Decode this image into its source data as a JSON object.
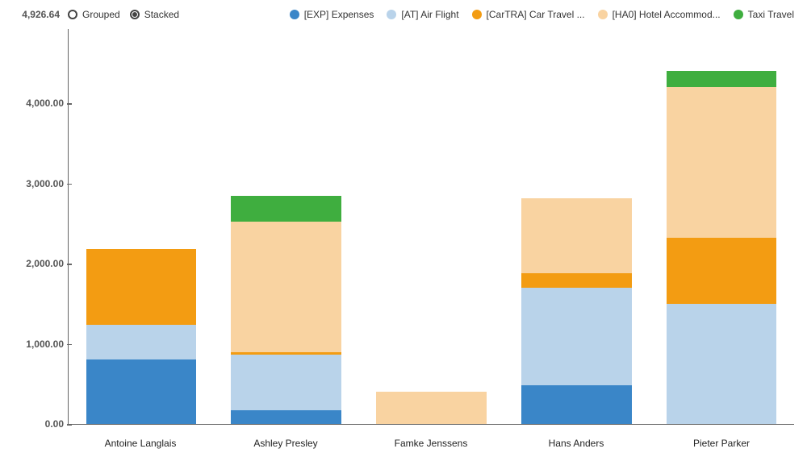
{
  "controls": {
    "grouped_label": "Grouped",
    "stacked_label": "Stacked",
    "selected": "stacked"
  },
  "legend": [
    {
      "key": "exp",
      "label": "[EXP] Expenses",
      "color": "#3a86c8"
    },
    {
      "key": "air",
      "label": "[AT] Air Flight",
      "color": "#b9d3ea"
    },
    {
      "key": "car",
      "label": "[CarTRA] Car Travel ...",
      "color": "#f39c12"
    },
    {
      "key": "hotel",
      "label": "[HA0] Hotel Accommod...",
      "color": "#f9d3a1"
    },
    {
      "key": "taxi",
      "label": "Taxi Travel",
      "color": "#3fae3f"
    }
  ],
  "max_label": "4,926.64",
  "yticks": [
    "0.00",
    "1,000.00",
    "2,000.00",
    "3,000.00",
    "4,000.00"
  ],
  "chart_data": {
    "type": "bar",
    "stacked": true,
    "ylim": [
      0,
      4926.64
    ],
    "categories": [
      "Antoine Langlais",
      "Ashley Presley",
      "Famke Jenssens",
      "Hans Anders",
      "Pieter Parker"
    ],
    "series": [
      {
        "name": "[EXP] Expenses",
        "key": "exp",
        "values": [
          800,
          170,
          0,
          480,
          0
        ]
      },
      {
        "name": "[AT] Air Flight",
        "key": "air",
        "values": [
          440,
          690,
          0,
          1220,
          1500
        ]
      },
      {
        "name": "[CarTRA] Car Travel ...",
        "key": "car",
        "values": [
          945,
          40,
          0,
          180,
          820
        ]
      },
      {
        "name": "[HA0] Hotel Accommod...",
        "key": "hotel",
        "values": [
          0,
          1620,
          400,
          940,
          1880
        ]
      },
      {
        "name": "Taxi Travel",
        "key": "taxi",
        "values": [
          0,
          330,
          0,
          0,
          200
        ]
      }
    ]
  }
}
